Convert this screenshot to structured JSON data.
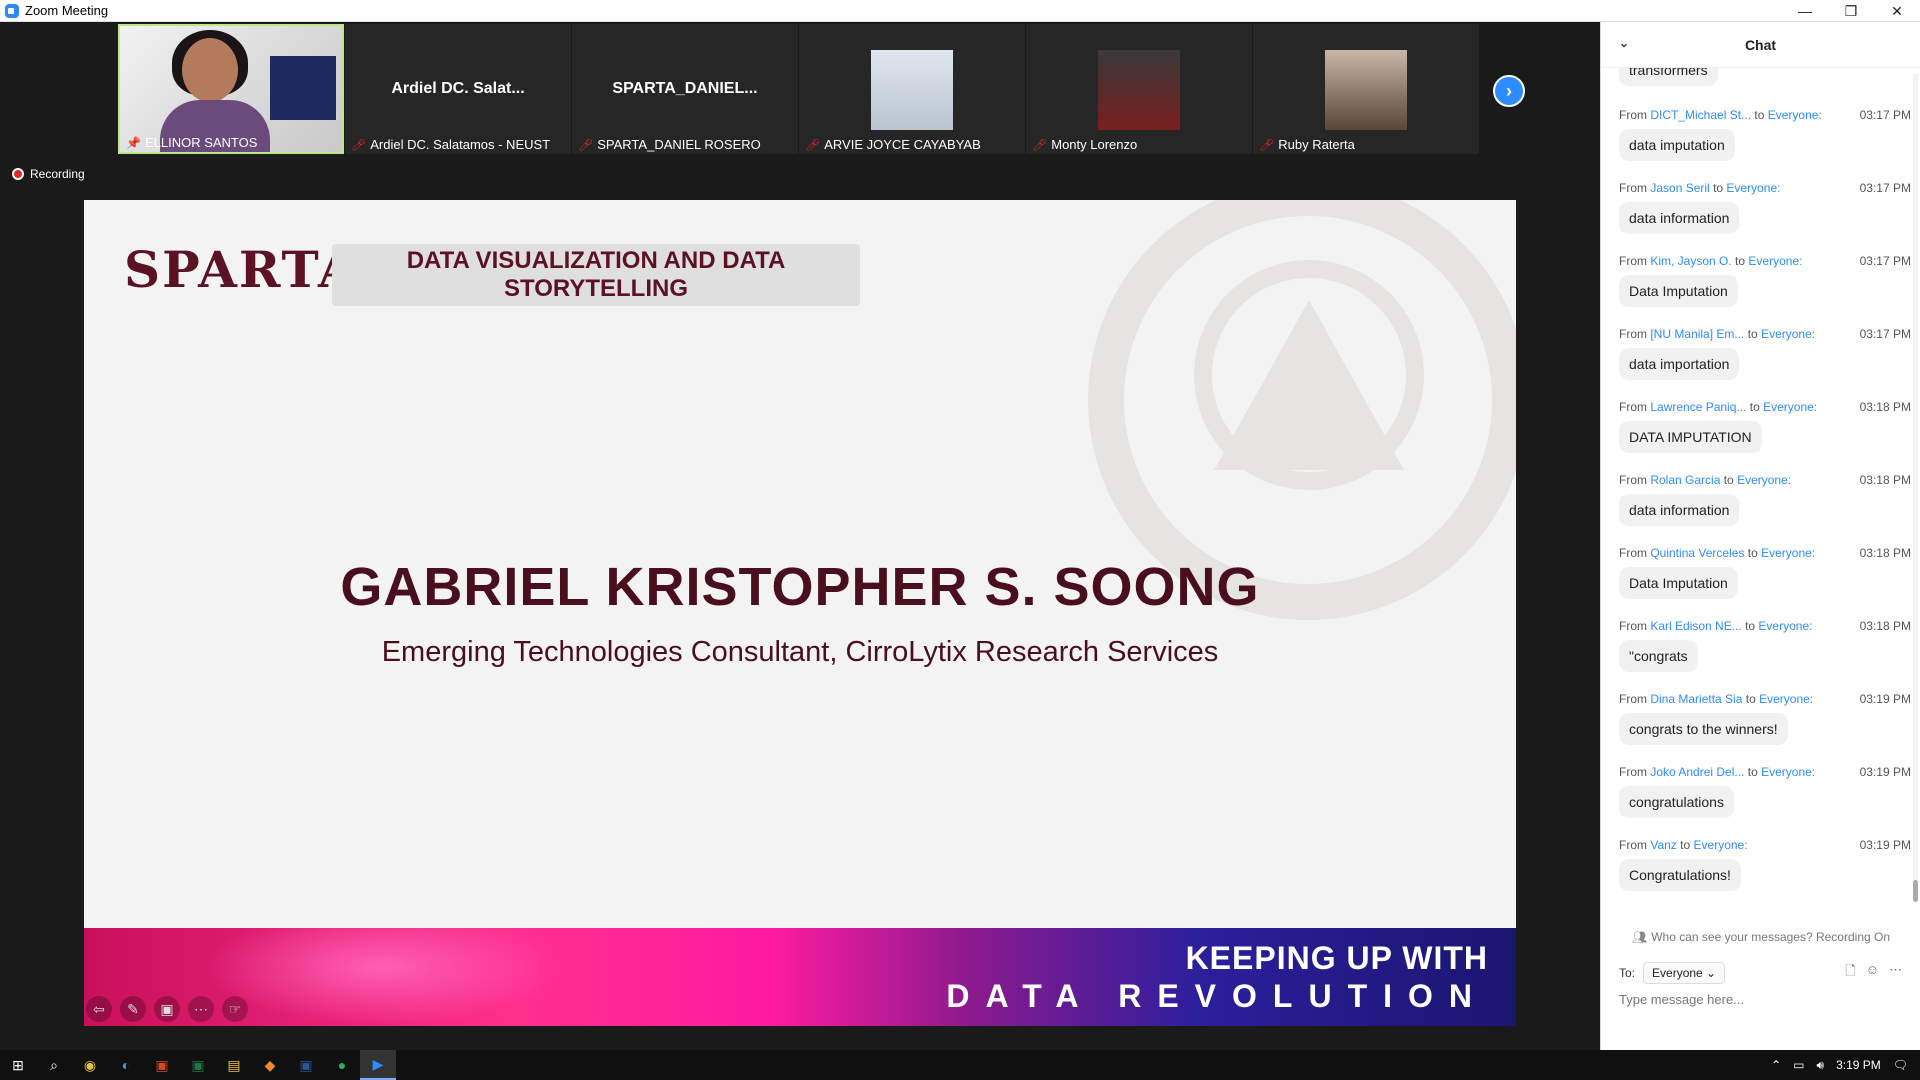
{
  "window": {
    "title": "Zoom Meeting",
    "minimize": "—",
    "restore": "❐",
    "close": "✕"
  },
  "participants": [
    {
      "display": "",
      "tag": "ELLINOR SANTOS"
    },
    {
      "display": "Ardiel DC. Salat...",
      "tag": "Ardiel DC. Salatamos - NEUST"
    },
    {
      "display": "SPARTA_DANIEL...",
      "tag": "SPARTA_DANIEL ROSERO"
    },
    {
      "display": "",
      "tag": "ARVIE JOYCE CAYABYAB"
    },
    {
      "display": "",
      "tag": "Monty Lorenzo"
    },
    {
      "display": "",
      "tag": "Ruby Raterta"
    }
  ],
  "recording_label": "Recording",
  "slide": {
    "logo": "SPARTA",
    "title": "DATA VISUALIZATION AND DATA STORYTELLING",
    "speaker": "GABRIEL KRISTOPHER S. SOONG",
    "role": "Emerging Technologies Consultant, CirroLytix Research Services",
    "banner_line1": "KEEPING UP WITH",
    "banner_line2": "DATA REVOLUTION"
  },
  "chat": {
    "header": "Chat",
    "first_bubble": "transformers",
    "messages": [
      {
        "from": "DICT_Michael St...",
        "to": "Everyone:",
        "time": "03:17 PM",
        "text": "data imputation"
      },
      {
        "from": "Jason Seril",
        "to": "Everyone:",
        "time": "03:17 PM",
        "text": "data information"
      },
      {
        "from": "Kim, Jayson O.",
        "to": "Everyone:",
        "time": "03:17 PM",
        "text": "Data Imputation"
      },
      {
        "from": "[NU Manila] Em...",
        "to": "Everyone:",
        "time": "03:17 PM",
        "text": "data importation"
      },
      {
        "from": "Lawrence Paniq...",
        "to": "Everyone:",
        "time": "03:18 PM",
        "text": "DATA IMPUTATION"
      },
      {
        "from": "Rolan Garcia",
        "to": "Everyone:",
        "time": "03:18 PM",
        "text": "data information"
      },
      {
        "from": "Quintina Verceles",
        "to": "Everyone:",
        "time": "03:18 PM",
        "text": "Data Imputation"
      },
      {
        "from": "Karl Edison NE...",
        "to": "Everyone:",
        "time": "03:18 PM",
        "text": "\"congrats"
      },
      {
        "from": "Dina Marietta Sia",
        "to": "Everyone:",
        "time": "03:19 PM",
        "text": "congrats to the winners!"
      },
      {
        "from": "Joko Andrei Del...",
        "to": "Everyone:",
        "time": "03:19 PM",
        "text": "congratulations"
      },
      {
        "from": "Vanz",
        "to": "Everyone:",
        "time": "03:19 PM",
        "text": "Congratulations!"
      }
    ],
    "from_word": "From",
    "to_word": "to",
    "privacy": "Who can see your messages? Recording On",
    "to_label": "To:",
    "to_value": "Everyone",
    "placeholder": "Type message here..."
  },
  "taskbar": {
    "time": "3:19 PM"
  }
}
